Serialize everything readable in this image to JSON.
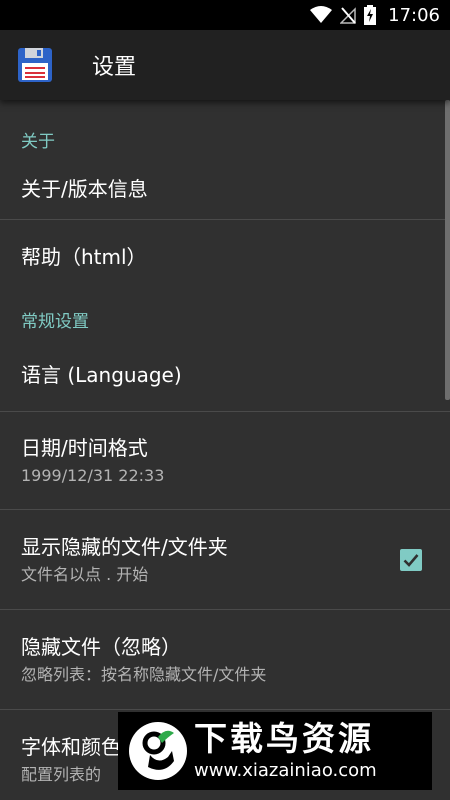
{
  "status_bar": {
    "time": "17:06"
  },
  "app_bar": {
    "title": "设置",
    "icon": "floppy-disk-icon"
  },
  "sections": {
    "about": {
      "header": "关于",
      "about_version": "关于/版本信息",
      "help": "帮助（html）"
    },
    "general": {
      "header": "常规设置",
      "language": "语言 (Language)",
      "datetime_title": "日期/时间格式",
      "datetime_value": "1999/12/31  22:33",
      "show_hidden_title": "显示隐藏的文件/文件夹",
      "show_hidden_summary": "文件名以点 . 开始",
      "show_hidden_checked": true,
      "hide_files_title": "隐藏文件（忽略）",
      "hide_files_summary": "忽略列表：按名称隐藏文件/文件夹",
      "font_color_title": "字体和颜色",
      "font_color_summary": "配置列表的"
    }
  },
  "watermark": {
    "title": "下载鸟资源",
    "url": "www.xiazainiao.com"
  },
  "colors": {
    "accent": "#80cbc4",
    "background": "#303030",
    "appbar": "#212121"
  }
}
